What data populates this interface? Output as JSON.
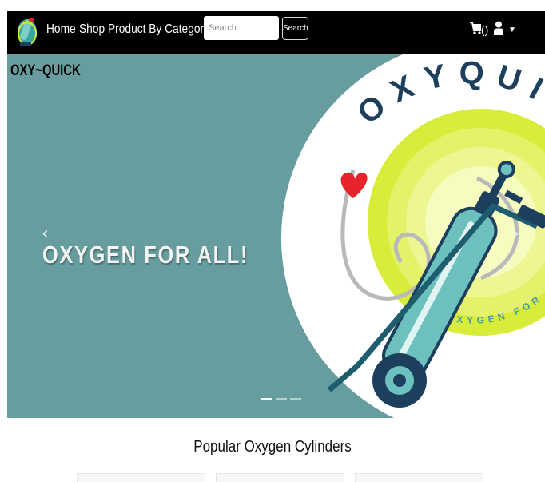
{
  "navbar": {
    "logo_icon": "oxygen-cylinder-logo-icon",
    "links": [
      {
        "label": "Home"
      },
      {
        "label": "Shop"
      },
      {
        "label": "Product By Category"
      }
    ],
    "search": {
      "placeholder": "Search",
      "value": "",
      "button_label": "Search"
    },
    "cart": {
      "icon": "cart-icon",
      "count_text": "()"
    },
    "user": {
      "icon": "user-icon",
      "dropdown_icon": "caret-down-icon"
    }
  },
  "hero": {
    "brand": "OXY~QUICK",
    "tagline": "OXYGEN FOR ALL!",
    "prev_icon": "chevron-left-icon",
    "next_icon": "chevron-right-icon",
    "logo_text": {
      "top": "OXYQUICK",
      "bottom": "OXYGEN FOR ALL"
    },
    "slides": 3,
    "active_slide": 1
  },
  "section": {
    "title": "Popular Oxygen Cylinders",
    "cards": 3
  },
  "colors": {
    "navbar_bg": "#000000",
    "hero_bg": "#679d9e",
    "logo_text": "#1d3f5e",
    "accent_yellow": "#d8ec3a",
    "heart_red": "#e5242d",
    "cylinder": "#6cc0be"
  }
}
